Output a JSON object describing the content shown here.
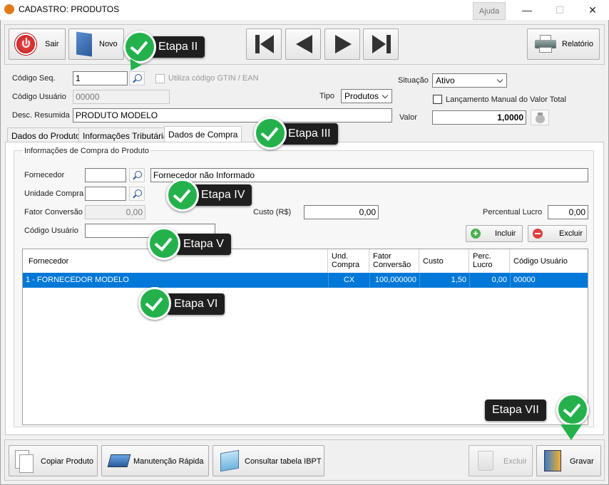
{
  "window": {
    "title": "CADASTRO: PRODUTOS",
    "help": "Ajuda",
    "minimize": "—",
    "maximize": "☐",
    "close": "✕"
  },
  "toolbar": {
    "exit": "Sair",
    "new": "Novo",
    "report": "Relatório"
  },
  "form": {
    "seq_code_label": "Código Seq.",
    "seq_code_value": "1",
    "gtin_label": "Utiliza código GTIN /  EAN",
    "user_code_label": "Código Usuário",
    "user_code_value": "00000",
    "type_label": "Tipo",
    "type_value": "Produtos",
    "desc_label": "Desc. Resumida",
    "desc_value": "PRODUTO MODELO",
    "status_label": "Situação",
    "status_value": "Ativo",
    "manual_label": "Lançamento Manual do Valor Total",
    "value_label": "Valor",
    "value_value": "1,0000"
  },
  "tabs": [
    "Dados do Produto",
    "Informações Tributárias",
    "Dados de Compra"
  ],
  "purchase": {
    "group_title": "Informações de Compra do Produto",
    "supplier_label": "Fornecedor",
    "supplier_code": "",
    "supplier_name": "Fornecedor não Informado",
    "unit_label": "Unidade Compra",
    "unit_value": "",
    "factor_label": "Fator Conversão",
    "factor_value": "0,00",
    "cost_label": "Custo (R$)",
    "cost_value": "0,00",
    "profit_label": "Percentual Lucro",
    "profit_value": "0,00",
    "usercode_label": "Código Usuário",
    "usercode_value": "",
    "include": "Incluir",
    "delete": "Excluir"
  },
  "grid": {
    "headers": [
      "Fornecedor",
      "Und.\nCompra",
      "Fator\nConversão",
      "Custo",
      "Perc.\nLucro",
      "Código Usuário"
    ],
    "rows": [
      {
        "supplier": "1 - FORNECEDOR MODELO",
        "unit": "CX",
        "factor": "100,000000",
        "cost": "1,50",
        "profit": "0,00",
        "user_code": "00000"
      }
    ]
  },
  "bottom": {
    "copy": "Copiar Produto",
    "quick": "Manutenção Rápida",
    "ibpt": "Consultar tabela IBPT",
    "delete": "Excluir",
    "save": "Gravar"
  },
  "steps": [
    "Etapa II",
    "Etapa III",
    "Etapa IV",
    "Etapa V",
    "Etapa VI",
    "Etapa VII"
  ],
  "colors": {
    "selection": "#0078d7",
    "step_green": "#24b14c",
    "step_label_bg": "#1f1f1f"
  }
}
